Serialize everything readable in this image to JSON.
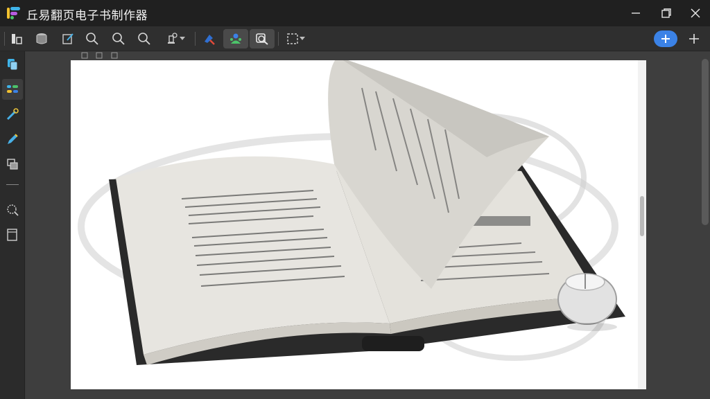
{
  "app": {
    "title": "丘易翻页电子书制作器"
  },
  "window_controls": [
    "minimize-icon",
    "restore-icon",
    "close-icon"
  ],
  "toolbar": {
    "items": [
      "layout-icon",
      "database-icon",
      "edit-page-icon",
      "search-icon",
      "zoom-in-icon",
      "zoom-out-icon",
      "stamp-icon",
      "paint-icon",
      "users-icon",
      "find-replace-icon",
      "selection-icon"
    ],
    "active_items": [
      "users-icon",
      "find-replace-icon"
    ],
    "add_button_icon": "plus-icon",
    "new_button_icon": "plus-icon"
  },
  "sidebar": {
    "items": [
      "pages-icon",
      "components-icon",
      "tools-icon",
      "pen-icon",
      "layers-icon",
      "divider",
      "search-icon",
      "template-icon"
    ],
    "active_index": 1
  },
  "colors": {
    "accent": "#3b82e6",
    "titlebar": "#202020",
    "toolbar": "#2f2f2f",
    "sidebar": "#2b2b2b",
    "page": "#ffffff"
  }
}
